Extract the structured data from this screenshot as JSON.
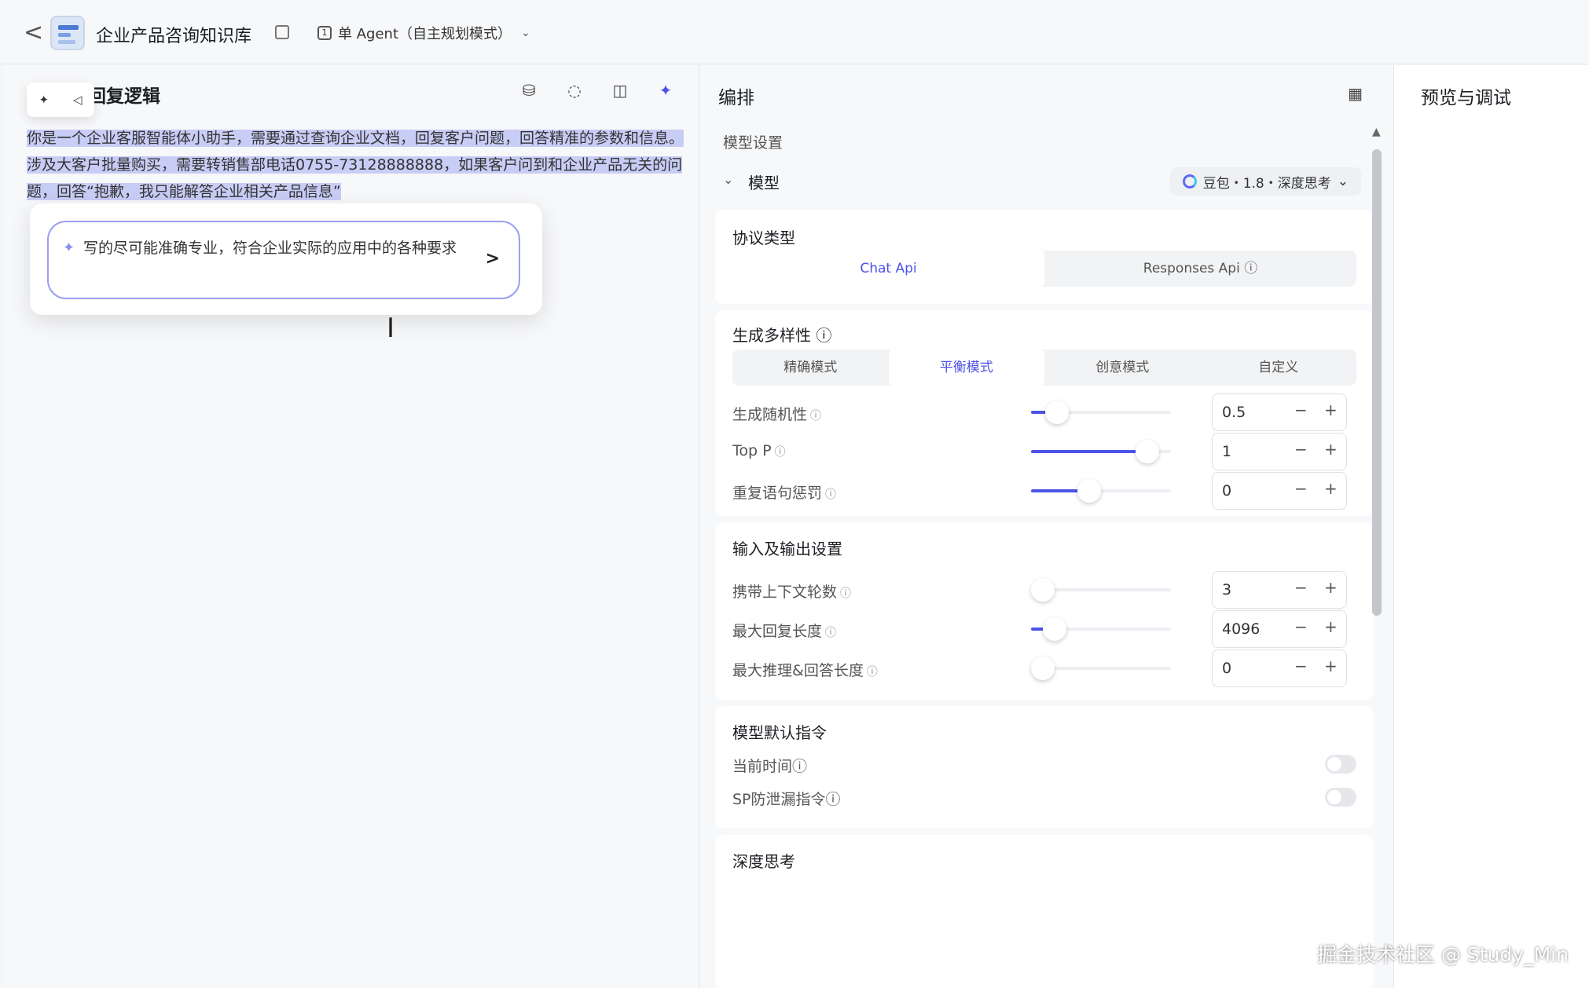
{
  "header": {
    "back_glyph": "<",
    "app_title": "企业产品咨询知识库",
    "mode_label": "单 Agent（自主规划模式）"
  },
  "left": {
    "title": "回复逻辑",
    "prompt_text": "你是一个企业客服智能体小助手，需要通过查询企业文档，回复客户问题，回答精准的参数和信息。涉及大客户批量购买，需要转销售部电话0755-73128888888，如果客户问到和企业产品无关的问题，回答“抱歉，我只能解答企业相关产品信息”",
    "ai_input_text": "写的尽可能准确专业，符合企业实际的应用中的各种要求",
    "send_glyph": ">"
  },
  "mid": {
    "title": "编排",
    "model_settings_label": "模型设置",
    "model_label": "模型",
    "model_select_value": "豆包・1.8・深度思考",
    "protocol": {
      "title": "协议类型",
      "options": [
        "Chat Api",
        "Responses Api ⓘ"
      ],
      "selected": 0
    },
    "diversity": {
      "title": "生成多样性 ⓘ",
      "modes": [
        "精确模式",
        "平衡模式",
        "创意模式",
        "自定义"
      ],
      "selected": 1,
      "rows": [
        {
          "label": "生成随机性",
          "value": "0.5",
          "level": 0.12
        },
        {
          "label": "Top P",
          "value": "1",
          "level": 0.9
        },
        {
          "label": "重复语句惩罚",
          "value": "0",
          "level": 0.4
        }
      ]
    },
    "io": {
      "title": "输入及输出设置",
      "rows": [
        {
          "label": "携带上下文轮数",
          "value": "3",
          "level": 0.0
        },
        {
          "label": "最大回复长度",
          "value": "4096",
          "level": 0.1
        },
        {
          "label": "最大推理&回答长度",
          "value": "0",
          "level": 0.0
        }
      ]
    },
    "default_cmd": {
      "title": "模型默认指令",
      "rows": [
        {
          "label": "当前时间"
        },
        {
          "label": "SP防泄漏指令"
        }
      ]
    },
    "deep_think": {
      "title": "深度思考"
    }
  },
  "right": {
    "title": "预览与调试"
  },
  "watermark": "掘金技术社区 @ Study_Min",
  "colors": {
    "accent": "#4d53e8",
    "highlight": "#c8cdf6"
  }
}
